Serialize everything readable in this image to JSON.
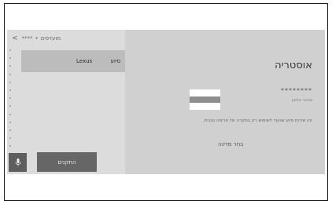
{
  "topbar": {
    "back_glyph": "<",
    "masked": "****",
    "separator": "•",
    "title": "מועדפים"
  },
  "list": {
    "item": {
      "label": "סיוע",
      "brand": "Lexus"
    }
  },
  "buttons": {
    "settings_label": "התקנים",
    "mic_icon": "microphone-icon"
  },
  "detail": {
    "country": "אוסטריה",
    "phone": "********",
    "phone_label": "מספר טלפון",
    "description": "זהו שירות סיוע שנועד לשימוש רק במקרה של פריסה טכנית.",
    "choose_city": "בחר מדינה",
    "flag_colors": [
      "#ffffff",
      "#8e8e8e",
      "#ffffff"
    ]
  },
  "colors": {
    "left_panel": "#dcdcdc",
    "right_panel": "#d0d0d0",
    "selected_item": "#bcbcbc",
    "button_dark": "#666666"
  }
}
